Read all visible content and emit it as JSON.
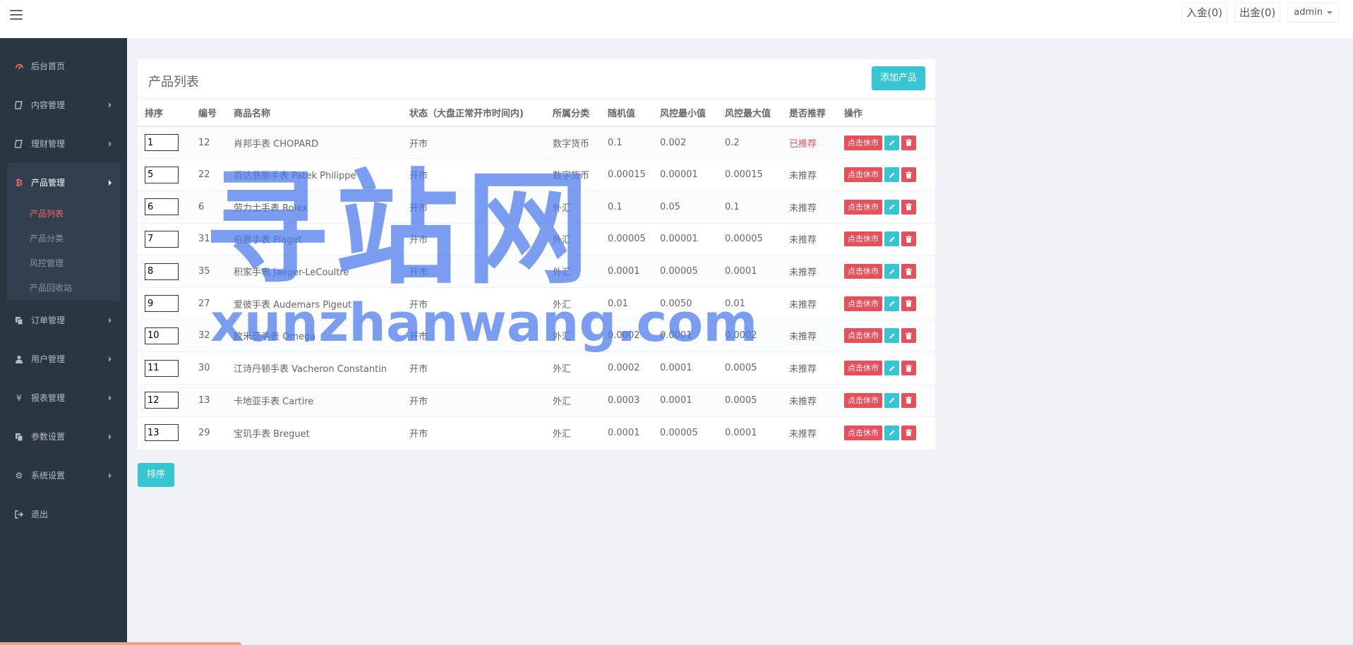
{
  "topbar": {
    "deposit_label": "入金(0)",
    "withdraw_label": "出金(0)",
    "user_label": "admin"
  },
  "sidebar": {
    "items": [
      {
        "label": "后台首页",
        "icon": "dashboard-icon"
      },
      {
        "label": "内容管理",
        "icon": "book-icon"
      },
      {
        "label": "理财管理",
        "icon": "book-icon"
      },
      {
        "label": "产品管理",
        "icon": "bitcoin-icon"
      },
      {
        "label": "订单管理",
        "icon": "copy-icon"
      },
      {
        "label": "用户管理",
        "icon": "user-icon"
      },
      {
        "label": "报表管理",
        "icon": "yen-icon"
      },
      {
        "label": "参数设置",
        "icon": "copy-icon"
      },
      {
        "label": "系统设置",
        "icon": "gears-icon"
      },
      {
        "label": "退出",
        "icon": "sign-out-icon"
      }
    ],
    "sub_items": [
      "产品列表",
      "产品分类",
      "风控管理",
      "产品回收站"
    ]
  },
  "panel": {
    "title": "产品列表",
    "add_label": "添加产品",
    "columns": [
      "排序",
      "编号",
      "商品名称",
      "状态（大盘正常开市时间内)",
      "所属分类",
      "随机值",
      "风控最小值",
      "风控最大值",
      "是否推荐",
      "操作"
    ],
    "rest_label": "点击休市",
    "rows": [
      {
        "sort": "1",
        "id": "12",
        "name": "肖邦手表 CHOPARD",
        "status": "开市",
        "category": "数字货币",
        "random": "0.1",
        "min": "0.002",
        "max": "0.2",
        "recommend": "已推荐"
      },
      {
        "sort": "5",
        "id": "22",
        "name": "百达翡丽手表 Patek Philippe",
        "status": "开市",
        "category": "数字货币",
        "random": "0.00015",
        "min": "0.00001",
        "max": "0.00015",
        "recommend": "未推荐"
      },
      {
        "sort": "6",
        "id": "6",
        "name": "劳力士手表 Rolex",
        "status": "开市",
        "category": "外汇",
        "random": "0.1",
        "min": "0.05",
        "max": "0.1",
        "recommend": "未推荐"
      },
      {
        "sort": "7",
        "id": "31",
        "name": "伯爵手表 Piaget",
        "status": "开市",
        "category": "外汇",
        "random": "0.00005",
        "min": "0.00001",
        "max": "0.00005",
        "recommend": "未推荐"
      },
      {
        "sort": "8",
        "id": "35",
        "name": "积家手表 Jaeger-LeCoultre",
        "status": "开市",
        "category": "外汇",
        "random": "0.0001",
        "min": "0.00005",
        "max": "0.0001",
        "recommend": "未推荐"
      },
      {
        "sort": "9",
        "id": "27",
        "name": "爱彼手表 Audemars Pigeut",
        "status": "开市",
        "category": "外汇",
        "random": "0.01",
        "min": "0.0050",
        "max": "0.01",
        "recommend": "未推荐"
      },
      {
        "sort": "10",
        "id": "32",
        "name": "欧米茄手表 Omega",
        "status": "开市",
        "category": "外汇",
        "random": "0.0002",
        "min": "0.0001",
        "max": "0.0002",
        "recommend": "未推荐"
      },
      {
        "sort": "11",
        "id": "30",
        "name": "江诗丹顿手表 Vacheron Constantin",
        "status": "开市",
        "category": "外汇",
        "random": "0.0002",
        "min": "0.0001",
        "max": "0.0005",
        "recommend": "未推荐"
      },
      {
        "sort": "12",
        "id": "13",
        "name": "卡地亚手表 Cartire",
        "status": "开市",
        "category": "外汇",
        "random": "0.0003",
        "min": "0.0001",
        "max": "0.0005",
        "recommend": "未推荐"
      },
      {
        "sort": "13",
        "id": "29",
        "name": "宝玑手表 Breguet",
        "status": "开市",
        "category": "外汇",
        "random": "0.0001",
        "min": "0.00005",
        "max": "0.0001",
        "recommend": "未推荐"
      }
    ],
    "sort_label": "排序"
  },
  "watermark": {
    "cn": "寻站网",
    "en": "xunzhanwang.com"
  },
  "colors": {
    "sidebar_bg": "#2b3643",
    "accent_teal": "#36c6d3",
    "accent_red": "#e7505a",
    "active_sub": "#f36a5a"
  }
}
